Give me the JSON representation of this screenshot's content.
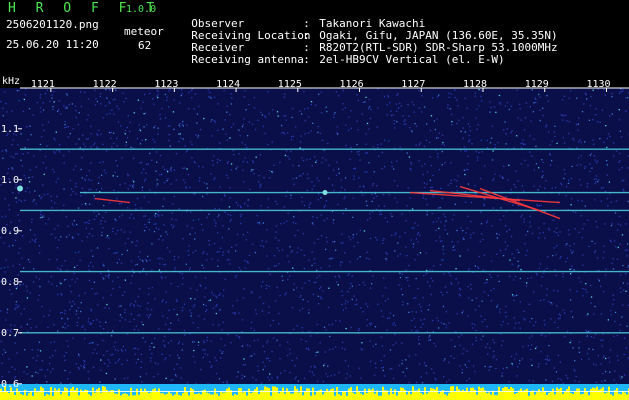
{
  "header": {
    "brand": "H R O F F T",
    "version": "1.0.0",
    "filename": "2506201120.png",
    "datetime": "25.06.20 11:20",
    "meteor_label": "meteor",
    "meteor_count": "62"
  },
  "info": [
    {
      "key": "Observer",
      "value": "Takanori Kawachi"
    },
    {
      "key": "Receiving Location",
      "value": "Ogaki, Gifu, JAPAN (136.60E, 35.35N)"
    },
    {
      "key": "Receiver",
      "value": "R820T2(RTL-SDR) SDR-Sharp 53.1000MHz"
    },
    {
      "key": "Receiving antenna",
      "value": "2el-HB9CV Vertical (el. E-W)"
    }
  ],
  "chart_data": {
    "type": "heatmap",
    "ylabel": "kHz",
    "x_ticks": [
      "1121",
      "1122",
      "1123",
      "1124",
      "1125",
      "1126",
      "1127",
      "1128",
      "1129",
      "1130"
    ],
    "y_ticks": [
      "1.1",
      "1.0",
      "0.9",
      "0.8",
      "0.7",
      "0.6"
    ],
    "ylim": [
      0.58,
      1.18
    ],
    "xlim": [
      1120.5,
      1130.3
    ],
    "horizontal_lines_khz": [
      1.06,
      0.975,
      0.94,
      0.82,
      0.7
    ]
  },
  "colors": {
    "background": "#000000",
    "noise": "#2a3ab0",
    "line": "#4fd6e0",
    "meteor": "#ff3a3a",
    "bottom_bar": "#ffff00",
    "bottom_fill": "#1fb7ff",
    "label_green": "#4ee64e"
  }
}
